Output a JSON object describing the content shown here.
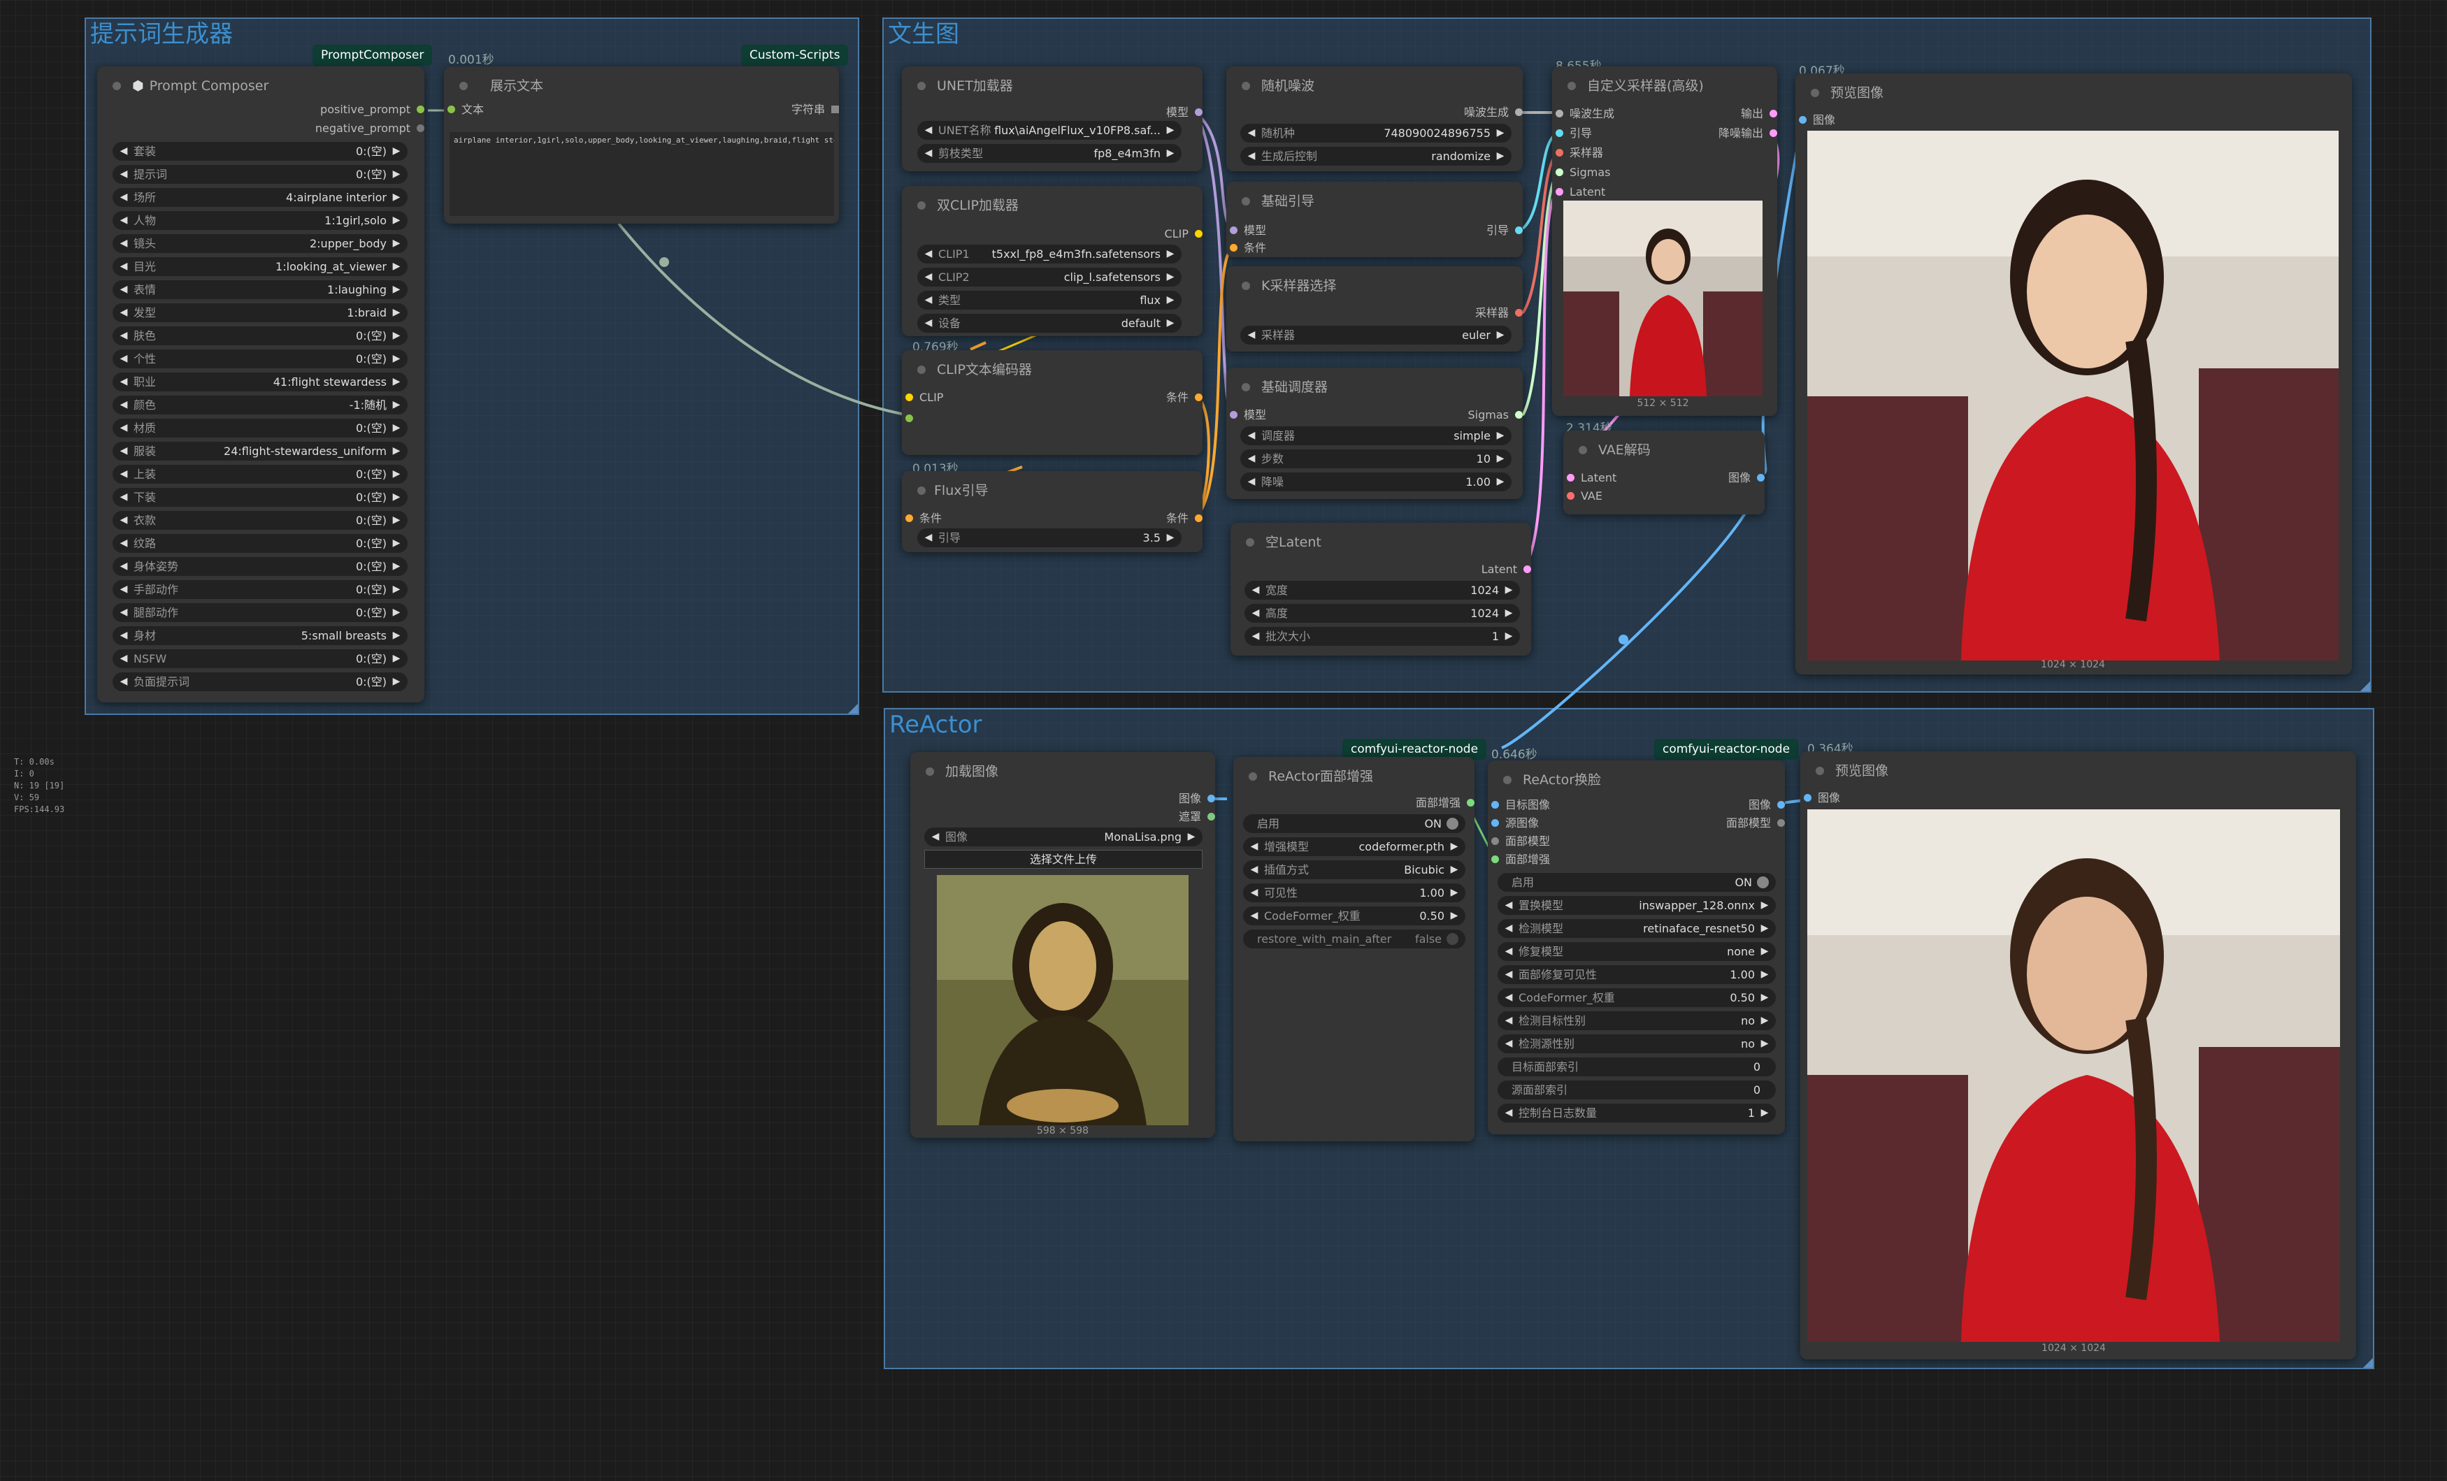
{
  "groups": {
    "prompt_gen": "提示词生成器",
    "txt2img": "文生图",
    "reactor": "ReActor"
  },
  "badges": {
    "prompt_composer": "PromptComposer",
    "custom_scripts": "Custom-Scripts",
    "reactor_node_1": "comfyui-reactor-node",
    "reactor_node_2": "comfyui-reactor-node"
  },
  "timings": {
    "show_text": "0.001秒",
    "clip_loader": "0.769秒",
    "flux_guide": "0.013秒",
    "ksampler": "8.655秒",
    "preview1": "0.067秒",
    "vae": "2.314秒",
    "reactor_swap": "0.646秒",
    "preview2": "0.364秒"
  },
  "prompt_composer": {
    "title": "Prompt Composer",
    "out_positive": "positive_prompt",
    "out_negative": "negative_prompt",
    "widgets": [
      {
        "label": "套装",
        "value": "0:(空)"
      },
      {
        "label": "提示词",
        "value": "0:(空)"
      },
      {
        "label": "场所",
        "value": "4:airplane interior"
      },
      {
        "label": "人物",
        "value": "1:1girl,solo"
      },
      {
        "label": "镜头",
        "value": "2:upper_body"
      },
      {
        "label": "目光",
        "value": "1:looking_at_viewer"
      },
      {
        "label": "表情",
        "value": "1:laughing"
      },
      {
        "label": "发型",
        "value": "1:braid"
      },
      {
        "label": "肤色",
        "value": "0:(空)"
      },
      {
        "label": "个性",
        "value": "0:(空)"
      },
      {
        "label": "职业",
        "value": "41:flight stewardess"
      },
      {
        "label": "颜色",
        "value": "-1:随机"
      },
      {
        "label": "材质",
        "value": "0:(空)"
      },
      {
        "label": "服装",
        "value": "24:flight-stewardess_uniform"
      },
      {
        "label": "上装",
        "value": "0:(空)"
      },
      {
        "label": "下装",
        "value": "0:(空)"
      },
      {
        "label": "衣款",
        "value": "0:(空)"
      },
      {
        "label": "纹路",
        "value": "0:(空)"
      },
      {
        "label": "身体姿势",
        "value": "0:(空)"
      },
      {
        "label": "手部动作",
        "value": "0:(空)"
      },
      {
        "label": "腿部动作",
        "value": "0:(空)"
      },
      {
        "label": "身材",
        "value": "5:small breasts"
      },
      {
        "label": "NSFW",
        "value": "0:(空)"
      },
      {
        "label": "负面提示词",
        "value": "0:(空)"
      }
    ]
  },
  "show_text": {
    "title": "展示文本",
    "in_text": "文本",
    "out_string": "字符串",
    "content": "airplane interior,1girl,solo,upper_body,looking_at_viewer,laughing,braid,flight stewardess,cz"
  },
  "unet_loader": {
    "title": "UNET加载器",
    "out_model": "模型",
    "w_name_label": "UNET名称",
    "w_name_value": "flux\\aiAngelFlux_v10FP8.saf...",
    "w_dtype_label": "剪枝类型",
    "w_dtype_value": "fp8_e4m3fn"
  },
  "dual_clip": {
    "title": "双CLIP加载器",
    "out_clip": "CLIP",
    "w1_label": "CLIP1",
    "w1_value": "t5xxl_fp8_e4m3fn.safetensors",
    "w2_label": "CLIP2",
    "w2_value": "clip_l.safetensors",
    "w3_label": "类型",
    "w3_value": "flux",
    "w4_label": "设备",
    "w4_value": "default"
  },
  "clip_encode": {
    "title": "CLIP文本编码器",
    "in_clip": "CLIP",
    "out_cond": "条件"
  },
  "flux_guide": {
    "title": "Flux引导",
    "in_cond": "条件",
    "out_cond": "条件",
    "w_label": "引导",
    "w_value": "3.5"
  },
  "random_noise": {
    "title": "随机噪波",
    "out_noise": "噪波生成",
    "w1_label": "随机种",
    "w1_value": "748090024896755",
    "w2_label": "生成后控制",
    "w2_value": "randomize"
  },
  "basic_guider": {
    "title": "基础引导",
    "in_model": "模型",
    "in_cond": "条件",
    "out_guider": "引导"
  },
  "ksampler_select": {
    "title": "K采样器选择",
    "out_sampler": "采样器",
    "w_label": "采样器",
    "w_value": "euler"
  },
  "basic_scheduler": {
    "title": "基础调度器",
    "in_model": "模型",
    "out_sigmas": "Sigmas",
    "w1_label": "调度器",
    "w1_value": "simple",
    "w2_label": "步数",
    "w2_value": "10",
    "w3_label": "降噪",
    "w3_value": "1.00"
  },
  "empty_latent": {
    "title": "空Latent",
    "out_latent": "Latent",
    "w1_label": "宽度",
    "w1_value": "1024",
    "w2_label": "高度",
    "w2_value": "1024",
    "w3_label": "批次大小",
    "w3_value": "1"
  },
  "custom_sampler": {
    "title": "自定义采样器(高级)",
    "in_noise": "噪波生成",
    "in_guider": "引导",
    "in_sampler": "采样器",
    "in_sigmas": "Sigmas",
    "in_latent": "Latent",
    "out_output": "输出",
    "out_denoised": "降噪输出",
    "img_caption": "512 × 512"
  },
  "vae_decode": {
    "title": "VAE解码",
    "in_latent": "Latent",
    "in_vae": "VAE",
    "out_image": "图像"
  },
  "preview1": {
    "title": "预览图像",
    "in_image": "图像",
    "img_caption": "1024 × 1024"
  },
  "load_image": {
    "title": "加载图像",
    "out_image": "图像",
    "out_mask": "遮罩",
    "w_label": "图像",
    "w_value": "MonaLisa.png",
    "upload": "选择文件上传",
    "img_caption": "598 × 598"
  },
  "face_boost": {
    "title": "ReActor面部增强",
    "out_boost": "面部增强",
    "toggle_label": "启用",
    "toggle_value": "ON",
    "w1_label": "增强模型",
    "w1_value": "codeformer.pth",
    "w2_label": "插值方式",
    "w2_value": "Bicubic",
    "w3_label": "可见性",
    "w3_value": "1.00",
    "w4_label": "CodeFormer_权重",
    "w4_value": "0.50",
    "toggle2_label": "restore_with_main_after",
    "toggle2_value": "false"
  },
  "face_swap": {
    "title": "ReActor换脸",
    "in_target": "目标图像",
    "in_source": "源图像",
    "in_face_model": "面部模型",
    "in_face_boost": "面部增强",
    "out_image": "图像",
    "out_face_model": "面部模型",
    "toggle_label": "启用",
    "toggle_value": "ON",
    "w1_label": "置换模型",
    "w1_value": "inswapper_128.onnx",
    "w2_label": "检测模型",
    "w2_value": "retinaface_resnet50",
    "w3_label": "修复模型",
    "w3_value": "none",
    "w4_label": "面部修复可见性",
    "w4_value": "1.00",
    "w5_label": "CodeFormer_权重",
    "w5_value": "0.50",
    "w6_label": "检测目标性别",
    "w6_value": "no",
    "w7_label": "检测源性别",
    "w7_value": "no",
    "w8_label": "目标面部索引",
    "w8_value": "0",
    "w9_label": "源面部索引",
    "w9_value": "0",
    "w10_label": "控制台日志数量",
    "w10_value": "1"
  },
  "preview2": {
    "title": "预览图像",
    "in_image": "图像",
    "img_caption": "1024 × 1024"
  },
  "stats": {
    "t": "T: 0.00s",
    "i": "I: 0",
    "n": "N: 19 [19]",
    "v": "V: 59",
    "fps": "FPS:144.93"
  },
  "colors": {
    "group_title": "#3c8fd0",
    "link_model": "#b39ddb",
    "link_clip": "#ffd500",
    "link_cond": "#ffa931",
    "link_latent": "#ff9cf9",
    "link_image": "#64b5f6",
    "link_noise": "#b0b0b0",
    "link_sigmas": "#cdffcd",
    "link_string": "#8bc34a"
  }
}
